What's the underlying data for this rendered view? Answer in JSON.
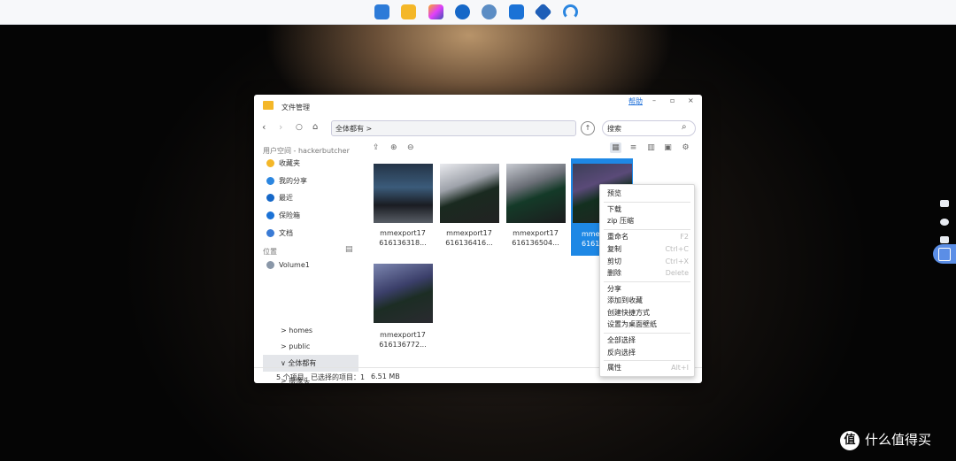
{
  "dock": {
    "icons": [
      {
        "name": "control-panel-icon",
        "color": "#2d7bd8"
      },
      {
        "name": "file-manager-icon",
        "color": "#f4b728"
      },
      {
        "name": "photos-icon",
        "color": "#c54ee0"
      },
      {
        "name": "clock-icon",
        "color": "#1668c8"
      },
      {
        "name": "settings-icon",
        "color": "#5c8dc4"
      },
      {
        "name": "mail-icon",
        "color": "#1b72d6"
      },
      {
        "name": "package-icon",
        "color": "#1f5fb8"
      },
      {
        "name": "support-icon",
        "color": "#2b86e0"
      }
    ]
  },
  "window": {
    "title": "文件管理",
    "help": "帮助",
    "min_glyph": "–",
    "max_glyph": "▫",
    "close_glyph": "×",
    "back_glyph": "‹",
    "forward_glyph": "›",
    "refresh_glyph": "○",
    "home_glyph": "⌂",
    "path": "全体都有 >",
    "path_up_glyph": "↑",
    "search_placeholder": "搜索",
    "search_glyph": "⌕"
  },
  "toolbar": {
    "upload_glyph": "⇪",
    "new_glyph": "⊕",
    "more_glyph": "⊖",
    "grid_glyph": "▦",
    "list_glyph": "≡",
    "columns_glyph": "▥",
    "image_glyph": "▣",
    "settings_glyph": "⚙"
  },
  "sidebar": {
    "user_space": "用户空间 - hackerbutcher",
    "items": [
      {
        "label": "收藏夹",
        "color": "#f4b728"
      },
      {
        "label": "我的分享",
        "color": "#2b86e0"
      },
      {
        "label": "最近",
        "color": "#1668c8"
      },
      {
        "label": "保险箱",
        "color": "#1b72d6"
      },
      {
        "label": "文档",
        "color": "#3a7bd5"
      }
    ],
    "location": "位置",
    "location_glyph": "▤",
    "volume": "Volume1",
    "tree": [
      {
        "label": "homes",
        "arrow": ">"
      },
      {
        "label": "public",
        "arrow": ">"
      },
      {
        "label": "全体都有",
        "arrow": "∨"
      },
      {
        "label": "摄像头",
        "arrow": ">"
      }
    ]
  },
  "files": [
    {
      "line1": "mmexport17",
      "line2": "616136318..."
    },
    {
      "line1": "mmexport17",
      "line2": "616136416..."
    },
    {
      "line1": "mmexport17",
      "line2": "616136504..."
    },
    {
      "line1": "mme",
      "line2": "6161"
    },
    {
      "line1": "mmexport17",
      "line2": "616136772..."
    }
  ],
  "status": {
    "count": "5 个项目",
    "selected": "已选择的项目：1",
    "size": "6.51 MB"
  },
  "context_menu": {
    "items": [
      {
        "label": "预览",
        "shortcut": ""
      },
      {
        "label": "下载",
        "shortcut": ""
      },
      {
        "label": "zip 压缩",
        "shortcut": ""
      },
      {
        "label": "重命名",
        "shortcut": "F2"
      },
      {
        "label": "复制",
        "shortcut": "Ctrl+C"
      },
      {
        "label": "剪切",
        "shortcut": "Ctrl+X"
      },
      {
        "label": "删除",
        "shortcut": "Delete"
      },
      {
        "label": "分享",
        "shortcut": ""
      },
      {
        "label": "添加到收藏",
        "shortcut": ""
      },
      {
        "label": "创建快捷方式",
        "shortcut": ""
      },
      {
        "label": "设置为桌面壁纸",
        "shortcut": ""
      },
      {
        "label": "全部选择",
        "shortcut": ""
      },
      {
        "label": "反向选择",
        "shortcut": ""
      },
      {
        "label": "属性",
        "shortcut": "Alt+I"
      }
    ]
  },
  "watermark": {
    "badge": "值",
    "text": "什么值得买"
  }
}
